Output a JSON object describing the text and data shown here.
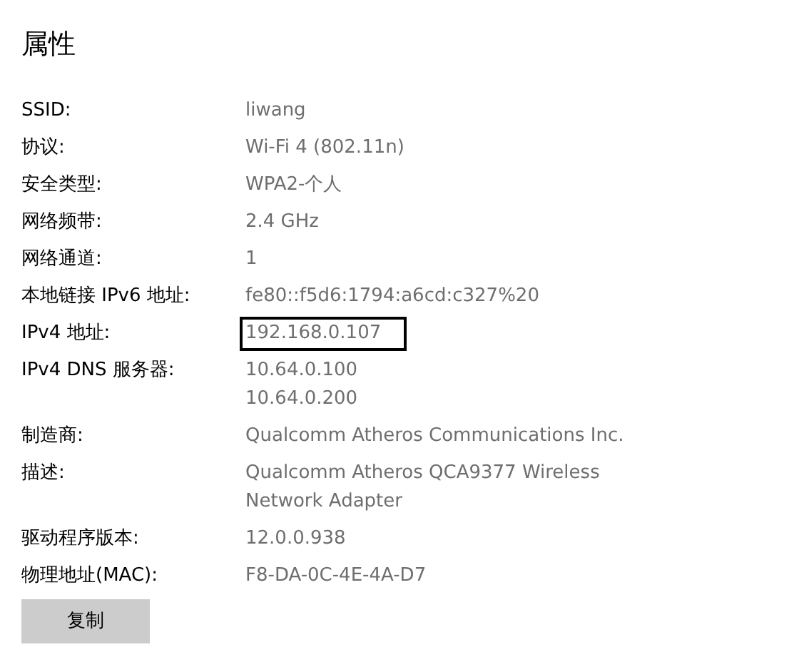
{
  "title": "属性",
  "properties": [
    {
      "label": "SSID:",
      "value": [
        "liwang"
      ],
      "highlighted": false
    },
    {
      "label": "协议:",
      "value": [
        "Wi-Fi 4 (802.11n)"
      ],
      "highlighted": false
    },
    {
      "label": "安全类型:",
      "value": [
        "WPA2-个人"
      ],
      "highlighted": false
    },
    {
      "label": "网络频带:",
      "value": [
        "2.4 GHz"
      ],
      "highlighted": false
    },
    {
      "label": "网络通道:",
      "value": [
        "1"
      ],
      "highlighted": false
    },
    {
      "label": "本地链接 IPv6 地址:",
      "value": [
        "fe80::f5d6:1794:a6cd:c327%20"
      ],
      "highlighted": false
    },
    {
      "label": "IPv4 地址:",
      "value": [
        "192.168.0.107"
      ],
      "highlighted": true
    },
    {
      "label": "IPv4 DNS 服务器:",
      "value": [
        "10.64.0.100",
        "10.64.0.200"
      ],
      "highlighted": false
    },
    {
      "label": "制造商:",
      "value": [
        "Qualcomm Atheros Communications Inc."
      ],
      "highlighted": false
    },
    {
      "label": "描述:",
      "value": [
        "Qualcomm Atheros QCA9377 Wireless",
        "Network Adapter"
      ],
      "highlighted": false
    },
    {
      "label": "驱动程序版本:",
      "value": [
        "12.0.0.938"
      ],
      "highlighted": false
    },
    {
      "label": "物理地址(MAC):",
      "value": [
        "F8-DA-0C-4E-4A-D7"
      ],
      "highlighted": false
    }
  ],
  "button": "复制"
}
